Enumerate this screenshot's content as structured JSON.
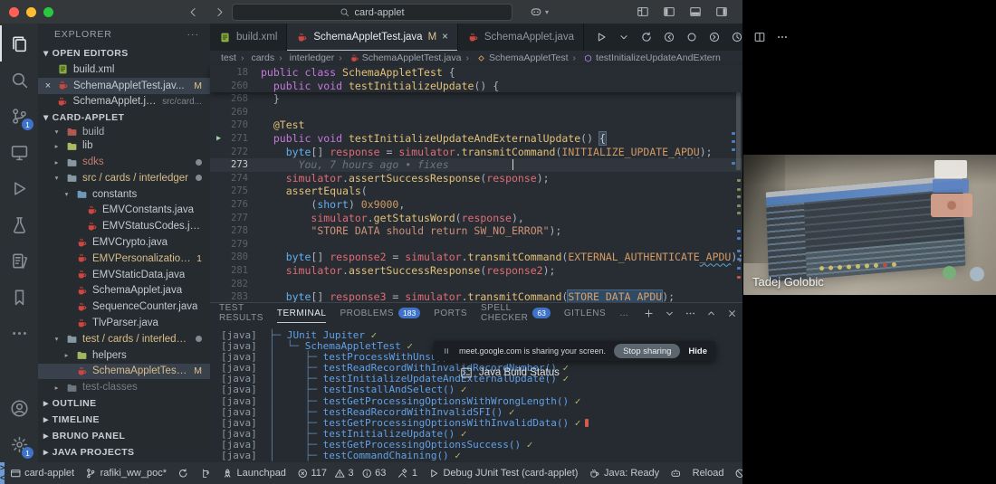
{
  "title_bar": {
    "search_value": "card-applet",
    "traffic_lights": [
      "close",
      "minimize",
      "zoom"
    ],
    "traffic_colors": [
      "#ff5f57",
      "#febc2e",
      "#28c840"
    ],
    "window_icons": [
      "layout",
      "panel-left",
      "panel-bottom",
      "panel-right"
    ]
  },
  "activity_bar": {
    "top": [
      {
        "icon": "files",
        "active": true
      },
      {
        "icon": "search"
      },
      {
        "icon": "source-control",
        "badge": "1"
      },
      {
        "icon": "remote-explorer"
      },
      {
        "icon": "run-debug"
      },
      {
        "icon": "testing"
      },
      {
        "icon": "snippets"
      },
      {
        "icon": "bookmarks"
      },
      {
        "icon": "more"
      }
    ],
    "bottom": [
      {
        "icon": "account"
      },
      {
        "icon": "settings",
        "badge": "1"
      }
    ]
  },
  "sidebar": {
    "title": "EXPLORER",
    "open_editors_label": "OPEN EDITORS",
    "open_editors": [
      {
        "icon": "xml",
        "label": "build.xml"
      },
      {
        "icon": "java",
        "label": "SchemaAppletTest.jav...",
        "badge": "M",
        "selected": true,
        "close": "×"
      },
      {
        "icon": "java",
        "label": "SchemaApplet.java",
        "detail": "src/card..."
      }
    ],
    "project_label": "CARD-APPLET",
    "tree": [
      {
        "type": "folder",
        "label": "build",
        "indent": 1,
        "expanded": true,
        "folderColor": "#b05a52",
        "labelColor": "#a7b0b8",
        "clipped": true
      },
      {
        "type": "folder",
        "label": "lib",
        "indent": 1,
        "folderColor": "#a9b964"
      },
      {
        "type": "folder",
        "label": "sdks",
        "indent": 1,
        "folderColor": "#8798a3",
        "labelColor": "#c47a72",
        "dot": true
      },
      {
        "type": "folder",
        "label": "src / cards / interledger",
        "indent": 1,
        "expanded": true,
        "folderColor": "#8798a3",
        "labelColor": "#d8bd8a",
        "dot": true
      },
      {
        "type": "folder",
        "label": "constants",
        "indent": 2,
        "expanded": true,
        "folderColor": "#6d98ba"
      },
      {
        "type": "file",
        "icon": "java",
        "label": "EMVConstants.java",
        "indent": 3
      },
      {
        "type": "file",
        "icon": "java",
        "label": "EMVStatusCodes.java",
        "indent": 3
      },
      {
        "type": "file",
        "icon": "java",
        "label": "EMVCrypto.java",
        "indent": 2
      },
      {
        "type": "file",
        "icon": "java",
        "label": "EMVPersonalization.java",
        "indent": 2,
        "labelColor": "#d8bd8a",
        "badge": "1"
      },
      {
        "type": "file",
        "icon": "java",
        "label": "EMVStaticData.java",
        "indent": 2
      },
      {
        "type": "file",
        "icon": "java",
        "label": "SchemaApplet.java",
        "indent": 2
      },
      {
        "type": "file",
        "icon": "java",
        "label": "SequenceCounter.java",
        "indent": 2
      },
      {
        "type": "file",
        "icon": "java",
        "label": "TlvParser.java",
        "indent": 2
      },
      {
        "type": "folder",
        "label": "test / cards / interledger",
        "indent": 1,
        "expanded": true,
        "folderColor": "#8798a3",
        "labelColor": "#d8bd8a",
        "dot": true
      },
      {
        "type": "folder",
        "label": "helpers",
        "indent": 2,
        "folderColor": "#9fb760"
      },
      {
        "type": "file",
        "icon": "java",
        "label": "SchemaAppletTest.java",
        "indent": 2,
        "labelColor": "#d8bd8a",
        "badge": "M",
        "selected": true
      },
      {
        "type": "folder",
        "label": "test-classes",
        "indent": 1,
        "labelColor": "#747e87",
        "folderColor": "#6d7780"
      }
    ],
    "sections": [
      "OUTLINE",
      "TIMELINE",
      "BRUNO PANEL",
      "JAVA PROJECTS"
    ]
  },
  "editor": {
    "tabs": [
      {
        "icon": "xml",
        "label": "build.xml"
      },
      {
        "icon": "java",
        "label": "SchemaAppletTest.java",
        "modified": "M",
        "close": "×",
        "active": true
      },
      {
        "icon": "java",
        "label": "SchemaApplet.java"
      }
    ],
    "actions": [
      "run",
      "chevron",
      "sync-spin",
      "step-back",
      "circle",
      "step-forward",
      "history",
      "split",
      "more-h"
    ],
    "breadcrumbs": [
      {
        "label": "test"
      },
      {
        "label": "cards"
      },
      {
        "label": "interledger"
      },
      {
        "icon": "java",
        "label": "SchemaAppletTest.java"
      },
      {
        "icon": "class",
        "iconColor": "#e8ab53",
        "label": "SchemaAppletTest"
      },
      {
        "icon": "method",
        "iconColor": "#b180d7",
        "label": "testInitializeUpdateAndExtern"
      }
    ],
    "sticky_lines": [
      {
        "num": "18",
        "tokens": [
          [
            "kw",
            "public"
          ],
          [
            "pl",
            " "
          ],
          [
            "kw",
            "class"
          ],
          [
            "pl",
            " "
          ],
          [
            "fn",
            "SchemaAppletTest"
          ],
          [
            "pl",
            " {"
          ]
        ]
      },
      {
        "num": "260",
        "tokens": [
          [
            "pl",
            "  "
          ],
          [
            "kw",
            "public"
          ],
          [
            "pl",
            " "
          ],
          [
            "kw",
            "void"
          ],
          [
            "pl",
            " "
          ],
          [
            "fn",
            "testInitializeUpdate"
          ],
          [
            "pl",
            "() {"
          ]
        ]
      }
    ],
    "code_lines": [
      {
        "num": "268",
        "tokens": [
          [
            "pl",
            "  }"
          ]
        ]
      },
      {
        "num": "269",
        "tokens": []
      },
      {
        "num": "270",
        "tokens": [
          [
            "pl",
            "  "
          ],
          [
            "fn",
            "@Test"
          ]
        ]
      },
      {
        "num": "271",
        "run": true,
        "tokens": [
          [
            "pl",
            "  "
          ],
          [
            "kw",
            "public"
          ],
          [
            "pl",
            " "
          ],
          [
            "kw",
            "void"
          ],
          [
            "pl",
            " "
          ],
          [
            "fn",
            "testInitializeUpdateAndExternalUpdate"
          ],
          [
            "pl",
            "() "
          ],
          [
            "brkt",
            "{"
          ]
        ]
      },
      {
        "num": "272",
        "tokens": [
          [
            "pl",
            "    "
          ],
          [
            "ty",
            "byte"
          ],
          [
            "pl",
            "[] "
          ],
          [
            "vr",
            "response"
          ],
          [
            "pl",
            " = "
          ],
          [
            "vr",
            "simulator"
          ],
          [
            "pl",
            "."
          ],
          [
            "fn",
            "transmitCommand"
          ],
          [
            "pl",
            "("
          ],
          [
            "ct",
            "INITIALIZE_UPDATE"
          ],
          [
            "ctsq",
            "_APDU"
          ],
          [
            "pl",
            ");"
          ]
        ]
      },
      {
        "num": "273",
        "current": true,
        "cursor": 334,
        "tokens": [
          [
            "cm",
            "      You, 7 hours ago • fixes"
          ]
        ]
      },
      {
        "num": "274",
        "tokens": [
          [
            "pl",
            "    "
          ],
          [
            "vr",
            "simulator"
          ],
          [
            "pl",
            "."
          ],
          [
            "fn",
            "assertSuccessResponse"
          ],
          [
            "pl",
            "("
          ],
          [
            "vr",
            "response"
          ],
          [
            "pl",
            ");"
          ]
        ]
      },
      {
        "num": "275",
        "tokens": [
          [
            "pl",
            "    "
          ],
          [
            "fn",
            "assertEquals"
          ],
          [
            "pl",
            "("
          ]
        ]
      },
      {
        "num": "276",
        "tokens": [
          [
            "pl",
            "        ("
          ],
          [
            "ty",
            "short"
          ],
          [
            "pl",
            ") "
          ],
          [
            "ct",
            "0x9000"
          ],
          [
            "pl",
            ","
          ]
        ]
      },
      {
        "num": "277",
        "tokens": [
          [
            "pl",
            "        "
          ],
          [
            "vr",
            "simulator"
          ],
          [
            "pl",
            "."
          ],
          [
            "fn",
            "getStatusWord"
          ],
          [
            "pl",
            "("
          ],
          [
            "vr",
            "response"
          ],
          [
            "pl",
            "),"
          ]
        ]
      },
      {
        "num": "278",
        "tokens": [
          [
            "pl",
            "        "
          ],
          [
            "st",
            "\"STORE DATA should return SW_NO_ERROR\""
          ],
          [
            "pl",
            ");"
          ]
        ]
      },
      {
        "num": "279",
        "tokens": []
      },
      {
        "num": "280",
        "tokens": [
          [
            "pl",
            "    "
          ],
          [
            "ty",
            "byte"
          ],
          [
            "pl",
            "[] "
          ],
          [
            "vr",
            "response2"
          ],
          [
            "pl",
            " = "
          ],
          [
            "vr",
            "simulator"
          ],
          [
            "pl",
            "."
          ],
          [
            "fn",
            "transmitCommand"
          ],
          [
            "pl",
            "("
          ],
          [
            "ct",
            "EXTERNAL_AUTHENTICATE"
          ],
          [
            "ctsq",
            "_APDU"
          ],
          [
            "pl",
            ");"
          ]
        ]
      },
      {
        "num": "281",
        "tokens": [
          [
            "pl",
            "    "
          ],
          [
            "vr",
            "simulator"
          ],
          [
            "pl",
            "."
          ],
          [
            "fn",
            "assertSuccessResponse"
          ],
          [
            "pl",
            "("
          ],
          [
            "vr",
            "response2"
          ],
          [
            "pl",
            ");"
          ]
        ]
      },
      {
        "num": "282",
        "tokens": []
      },
      {
        "num": "283",
        "tokens": [
          [
            "pl",
            "    "
          ],
          [
            "ty",
            "byte"
          ],
          [
            "pl",
            "[] "
          ],
          [
            "vr",
            "response3"
          ],
          [
            "pl",
            " = "
          ],
          [
            "vr",
            "simulator"
          ],
          [
            "pl",
            "."
          ],
          [
            "fn",
            "transmitCommand"
          ],
          [
            "pl",
            "("
          ],
          [
            "ctsel",
            "STORE_DATA_APDU"
          ],
          [
            "pl",
            ");"
          ]
        ]
      }
    ]
  },
  "panel": {
    "tabs": [
      {
        "label": "TEST RESULTS"
      },
      {
        "label": "TERMINAL",
        "active": true
      },
      {
        "label": "PROBLEMS",
        "badge": "183"
      },
      {
        "label": "PORTS"
      },
      {
        "label": "SPELL CHECKER",
        "badge": "63"
      },
      {
        "label": "GITLENS"
      },
      {
        "label": "…"
      }
    ],
    "actions": [
      "plus",
      "chevron-down",
      "more-h",
      "chevron-up",
      "close"
    ],
    "terminal": [
      {
        "prefix": "[java]",
        "tree": "  ├─ ",
        "name": "JUnit Jupiter",
        "check": true
      },
      {
        "prefix": "[java]",
        "tree": "  │  └─ ",
        "name": "SchemaAppletTest",
        "check": true
      },
      {
        "prefix": "[java]",
        "tree": "  │     ├─ ",
        "name": "testProcessWithUnsupportedInstruction()",
        "check": true
      },
      {
        "prefix": "[java]",
        "tree": "  │     ├─ ",
        "name": "testReadRecordWithInvalidRecordNumber()",
        "check": true
      },
      {
        "prefix": "[java]",
        "tree": "  │     ├─ ",
        "name": "testInitializeUpdateAndExternalUpdate()",
        "check": true
      },
      {
        "prefix": "[java]",
        "tree": "  │     ├─ ",
        "name": "testInstallAndSelect()",
        "check": true
      },
      {
        "prefix": "[java]",
        "tree": "  │     ├─ ",
        "name": "testGetProcessingOptionsWithWrongLength()",
        "check": true
      },
      {
        "prefix": "[java]",
        "tree": "  │     ├─ ",
        "name": "testReadRecordWithInvalidSFI()",
        "check": true
      },
      {
        "prefix": "[java]",
        "tree": "  │     ├─ ",
        "name": "testGetProcessingOptionsWithInvalidData()",
        "check": true,
        "error": true
      },
      {
        "prefix": "[java]",
        "tree": "  │     ├─ ",
        "name": "testInitializeUpdate()",
        "check": true
      },
      {
        "prefix": "[java]",
        "tree": "  │     ├─ ",
        "name": "testGetProcessingOptionsSuccess()",
        "check": true
      },
      {
        "prefix": "[java]",
        "tree": "  │     ├─ ",
        "name": "testCommandChaining()",
        "check": true
      }
    ],
    "notification": {
      "text": "meet.google.com is sharing your screen.",
      "button": "Stop sharing",
      "link": "Hide"
    },
    "java_build_status": "Java Build Status"
  },
  "status_bar": {
    "remote_label": "><",
    "items": [
      {
        "icon": "window",
        "label": "card-applet"
      },
      {
        "icon": "branch",
        "label": "rafiki_ww_poc*"
      },
      {
        "icon": "sync"
      },
      {
        "icon": "compare"
      },
      {
        "icon": "rocket",
        "label": "Launchpad"
      },
      {
        "group": [
          {
            "icon": "error",
            "label": "117"
          },
          {
            "icon": "warning",
            "label": "3"
          },
          {
            "icon": "info",
            "label": "63"
          }
        ]
      },
      {
        "icon": "tools",
        "label": "1"
      },
      {
        "icon": "debug",
        "label": "Debug JUnit Test (card-applet)"
      },
      {
        "icon": "coffee",
        "label": "Java: Ready"
      },
      {
        "icon": "robot"
      },
      {
        "label": "Reload"
      },
      {
        "icon": "block"
      }
    ]
  },
  "video_call": {
    "participant_name": "Tadej Golobic"
  }
}
